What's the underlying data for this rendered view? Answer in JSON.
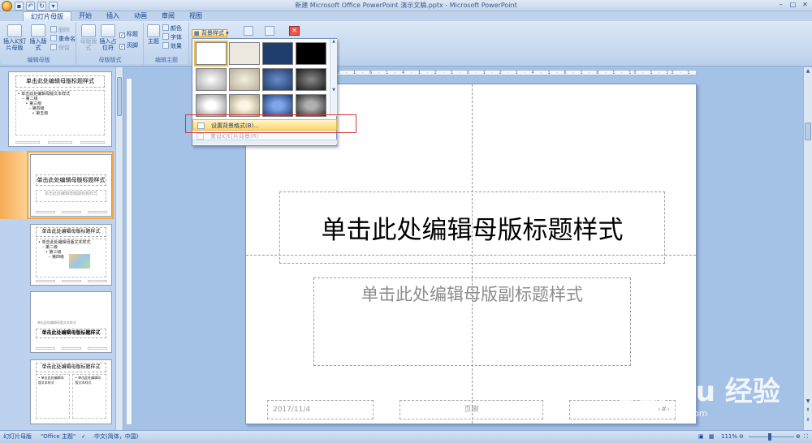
{
  "window": {
    "title": "新建 Microsoft Office PowerPoint 演示文稿.pptx - Microsoft PowerPoint"
  },
  "ribbon": {
    "tabs": [
      "幻灯片母版",
      "开始",
      "插入",
      "动画",
      "审阅",
      "视图"
    ],
    "edit_master": {
      "label": "编辑母版",
      "insert_master": "插入幻灯片母版",
      "insert_layout": "插入版式",
      "delete": "删除",
      "rename": "重命名",
      "preserve": "保留"
    },
    "master_layout": {
      "label": "母版版式",
      "master_layout_btn": "母版版式",
      "insert_placeholder": "插入占位符",
      "title_chk": "标题",
      "footer_chk": "页脚"
    },
    "edit_theme": {
      "label": "编辑主题",
      "theme": "主题",
      "colors": "颜色",
      "fonts": "字体",
      "effects": "效果"
    },
    "background_styles": "背景样式"
  },
  "dropdown": {
    "menu_items": [
      "设置背景格式(B)...",
      "重设幻灯片背景(R)"
    ]
  },
  "thumbnails": [
    {
      "title": "单击此处编辑母版标题样式",
      "body": [
        "• 单击此处编辑母版文本样式",
        "– 第二级",
        "• 第三级",
        "– 第四级",
        "» 第五级"
      ]
    },
    {
      "title": "单击此处编辑母版标题样式",
      "subtitle": "单击此处编辑母版副标题样式"
    },
    {
      "title": "单击此处编辑母版标题样式",
      "body": [
        "• 单击此处编辑母版文本样式",
        "– 第二级",
        "• 第三级",
        "– 第四级"
      ]
    },
    {
      "title": "单击此处编辑母版标题样式",
      "small": "单击此处编辑母版文本样式"
    },
    {
      "title": "单击此处编辑母版标题样式",
      "left": "• 单击此处编辑母版文本样式",
      "right": "• 单击此处编辑母版文本样式"
    }
  ],
  "slide": {
    "title": "单击此处编辑母版标题样式",
    "subtitle": "单击此处编辑母版副标题样式",
    "date": "2017/11/4",
    "footer": "页脚",
    "slide_number": "‹#›"
  },
  "statusbar": {
    "mode": "幻灯片母版",
    "theme": "\"Office 主题\"",
    "language": "中文(简体，中国)",
    "zoom": "111%"
  },
  "watermark": {
    "logo": "Bai du 经验",
    "url": "jingyan.baidu.com"
  },
  "ruler_text": "1 · 12 · 1 · 10 · 1 · 8 · 1 · 6 · 1 · 4 · 1 · 2 · 1 · 0 · 1 · 2 · 1 · 4 · 1 · 6 · 1 · 8 · 1 · 10 · 1 · 12 · 1"
}
